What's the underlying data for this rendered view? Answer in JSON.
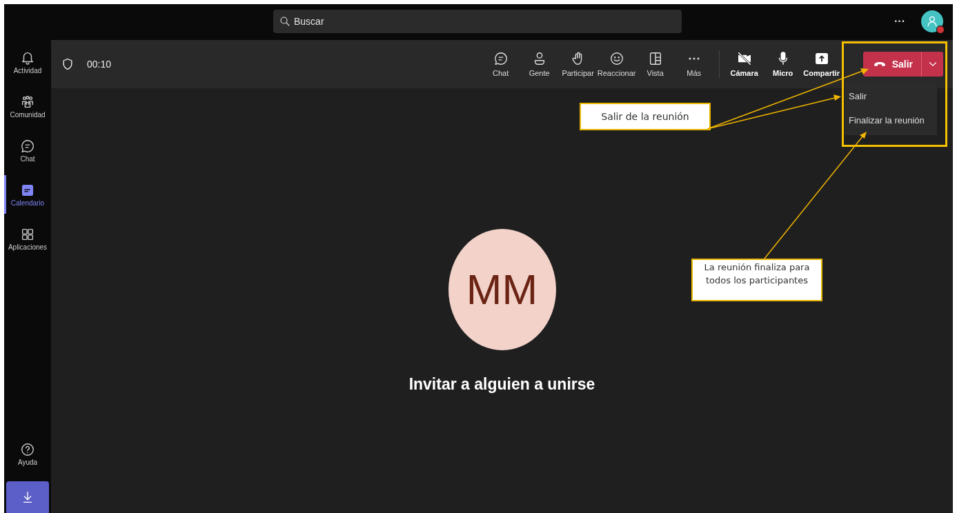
{
  "title_bar": {
    "search": {
      "placeholder": "Buscar"
    },
    "more": "···"
  },
  "sidebar": {
    "items": [
      {
        "label": "Actividad",
        "selected": false
      },
      {
        "label": "Comunidad",
        "selected": false
      },
      {
        "label": "Chat",
        "selected": false
      },
      {
        "label": "Calendario",
        "selected": true
      },
      {
        "label": "Aplicaciones",
        "selected": false
      }
    ],
    "help": "Ayuda"
  },
  "meeting_bar": {
    "timer": "00:10",
    "tools": [
      {
        "label": "Chat"
      },
      {
        "label": "Gente"
      },
      {
        "label": "Participar"
      },
      {
        "label": "Reaccionar"
      },
      {
        "label": "Vista"
      },
      {
        "label": "Más"
      }
    ],
    "devices": [
      {
        "label": "Cámara"
      },
      {
        "label": "Micro"
      },
      {
        "label": "Compartir"
      }
    ],
    "leave_button": "Salir"
  },
  "leave_menu": {
    "items": [
      "Salir",
      "Finalizar la reunión"
    ]
  },
  "stage": {
    "initials": "MM",
    "invite": "Invitar a alguien a unirse"
  },
  "annotations": [
    {
      "text": "Salir de la reunión"
    },
    {
      "text": "La reunión finaliza para todos los participantes"
    }
  ]
}
